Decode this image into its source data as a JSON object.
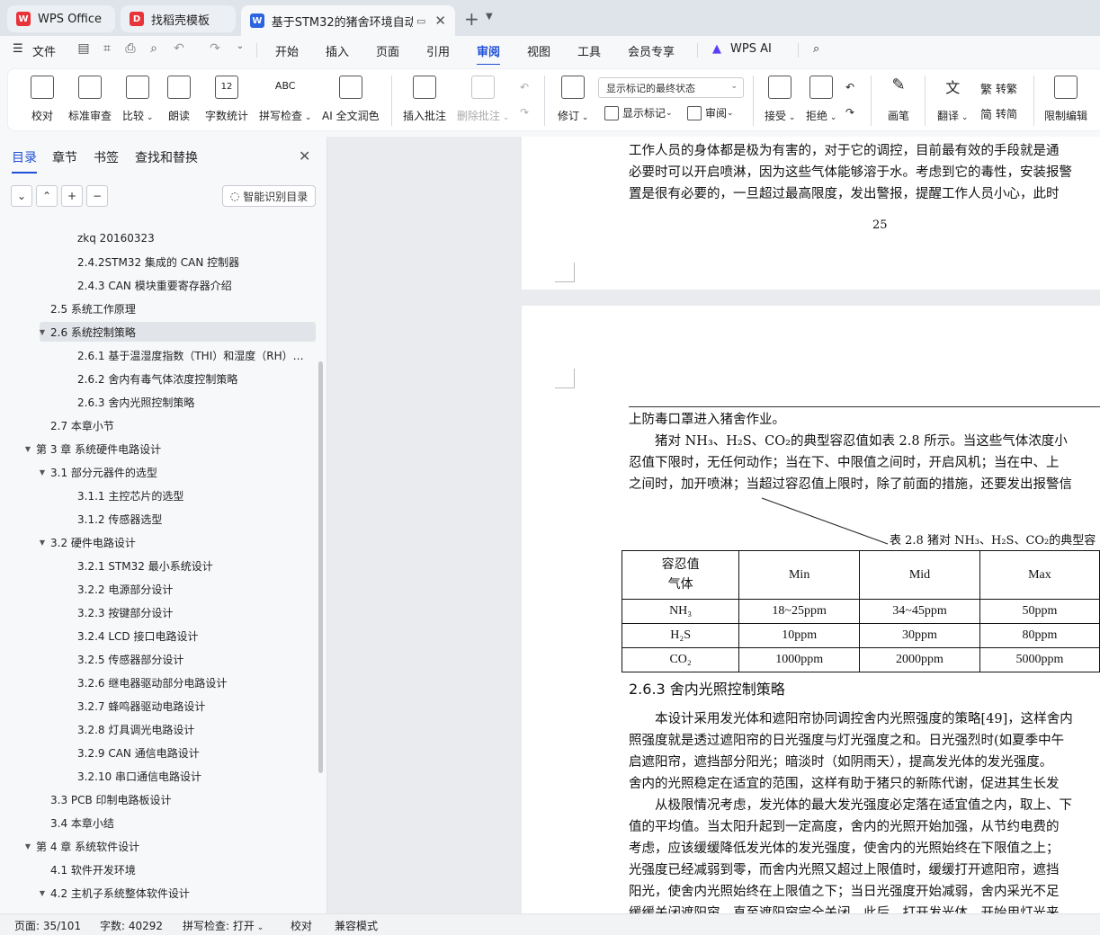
{
  "tabs": [
    {
      "label": "WPS Office"
    },
    {
      "label": "找稻壳模板"
    },
    {
      "label": "基于STM32的猪舍环境自动监"
    }
  ],
  "menu": {
    "file": "文件",
    "items": [
      "开始",
      "插入",
      "页面",
      "引用",
      "审阅",
      "视图",
      "工具",
      "会员专享",
      "WPS AI"
    ],
    "active": "审阅"
  },
  "ribbon": {
    "proofread": "校对",
    "standard_review": "标准审查",
    "compare": "比较",
    "read_aloud": "朗读",
    "word_count": "字数统计",
    "spell_check": "拼写检查",
    "ai_polish": "AI 全文润色",
    "insert_comment": "插入批注",
    "delete_comment": "删除批注",
    "track": "修订",
    "markup_select": "显示标记的最终状态",
    "show_markup": "显示标记",
    "review": "审阅",
    "accept": "接受",
    "reject": "拒绝",
    "pen": "画笔",
    "translate": "翻译",
    "to_traditional": "转繁",
    "to_simplified": "转简",
    "restrict_edit": "限制编辑",
    "abc": "ABC",
    "count_num": "12"
  },
  "nav": {
    "tabs": [
      "目录",
      "章节",
      "书签",
      "查找和替换"
    ],
    "smart_toc": "智能识别目录",
    "toc": [
      {
        "label": "zkq  20160323",
        "level": 3
      },
      {
        "label": "2.4.2STM32 集成的 CAN 控制器",
        "level": 3
      },
      {
        "label": "2.4.3 CAN 模块重要寄存器介绍",
        "level": 3
      },
      {
        "label": "2.5  系统工作原理",
        "level": 2
      },
      {
        "label": "2.6  系统控制策略",
        "level": 2,
        "expanded": true,
        "selected": true
      },
      {
        "label": "2.6.1 基于温湿度指数（THI）和湿度（RH）…",
        "level": 3
      },
      {
        "label": "2.6.2 舍内有毒气体浓度控制策略",
        "level": 3
      },
      {
        "label": "2.6.3 舍内光照控制策略",
        "level": 3
      },
      {
        "label": "2.7  本章小节",
        "level": 2
      },
      {
        "label": "第 3 章 系统硬件电路设计",
        "level": 1,
        "expanded": true
      },
      {
        "label": "3.1  部分元器件的选型",
        "level": 2,
        "expanded": true
      },
      {
        "label": "3.1.1 主控芯片的选型",
        "level": 3
      },
      {
        "label": "3.1.2 传感器选型",
        "level": 3
      },
      {
        "label": "3.2  硬件电路设计",
        "level": 2,
        "expanded": true
      },
      {
        "label": "3.2.1 STM32 最小系统设计",
        "level": 3
      },
      {
        "label": "3.2.2 电源部分设计",
        "level": 3
      },
      {
        "label": "3.2.3 按键部分设计",
        "level": 3
      },
      {
        "label": "3.2.4 LCD 接口电路设计",
        "level": 3
      },
      {
        "label": "3.2.5 传感器部分设计",
        "level": 3
      },
      {
        "label": "3.2.6 继电器驱动部分电路设计",
        "level": 3
      },
      {
        "label": "3.2.7 蜂鸣器驱动电路设计",
        "level": 3
      },
      {
        "label": "3.2.8 灯具调光电路设计",
        "level": 3
      },
      {
        "label": "3.2.9 CAN 通信电路设计",
        "level": 3
      },
      {
        "label": "3.2.10 串口通信电路设计",
        "level": 3
      },
      {
        "label": "3.3 PCB 印制电路板设计",
        "level": 2
      },
      {
        "label": "3.4  本章小结",
        "level": 2
      },
      {
        "label": "第 4 章 系统软件设计",
        "level": 1,
        "expanded": true
      },
      {
        "label": "4.1  软件开发环境",
        "level": 2
      },
      {
        "label": "4.2  主机子系统整体软件设计",
        "level": 2,
        "expanded": true
      }
    ]
  },
  "document": {
    "page1_lines": [
      "工作人员的身体都是极为有害的，对于它的调控，目前最有效的手段就是通",
      "必要时可以开启喷淋，因为这些气体能够溶于水。考虑到它的毒性，安装报警",
      "置是很有必要的，一旦超过最高限度，发出警报，提醒工作人员小心，此时"
    ],
    "page_number": "25",
    "page2_top_lines": [
      "上防毒口罩进入猪舍作业。",
      "　　猪对 NH₃、H₂S、CO₂的典型容忍值如表 2.8 所示。当这些气体浓度小",
      "忍值下限时，无任何动作；当在下、中限值之间时，开启风机；当在中、上",
      "之间时，加开喷淋；当超过容忍值上限时，除了前面的措施，还要发出报警信"
    ],
    "table_caption": "表 2.8  猪对 NH₃、H₂S、CO₂的典型容",
    "table": {
      "header_diag_top": "容忍值",
      "header_diag_bottom": "气体",
      "columns": [
        "Min",
        "Mid",
        "Max"
      ],
      "rows": [
        {
          "gas": "NH₃",
          "values": [
            "18~25ppm",
            "34~45ppm",
            "50ppm"
          ]
        },
        {
          "gas": "H₂S",
          "values": [
            "10ppm",
            "30ppm",
            "80ppm"
          ]
        },
        {
          "gas": "CO₂",
          "values": [
            "1000ppm",
            "2000ppm",
            "5000ppm"
          ]
        }
      ]
    },
    "heading": "2.6.3  舍内光照控制策略",
    "para_lines": [
      "　　本设计采用发光体和遮阳帘协同调控舍内光照强度的策略[49]，这样舍内",
      "照强度就是透过遮阳帘的日光强度与灯光强度之和。日光强烈时(如夏季中午",
      "启遮阳帘，遮挡部分阳光；暗淡时（如阴雨天），提高发光体的发光强度。",
      "舍内的光照稳定在适宜的范围，这样有助于猪只的新陈代谢，促进其生长发",
      "　　从极限情况考虑，发光体的最大发光强度必定落在适宜值之内，取上、下",
      "值的平均值。当太阳升起到一定高度，舍内的光照开始加强，从节约电费的",
      "考虑，应该缓缓降低发光体的发光强度，使舍内的光照始终在下限值之上；",
      "光强度已经减弱到零，而舍内光照又超过上限值时，缓缓打开遮阳帘，遮挡",
      "阳光，使舍内光照始终在上限值之下；当日光强度开始减弱，舍内采光不足",
      "缓缓关闭遮阳帘，直至遮阳帘完全关闭。此后，打开发光体，开始用灯光来"
    ]
  },
  "status": {
    "page": "页面: 35/101",
    "words": "字数: 40292",
    "spell": "拼写检查: 打开",
    "proof": "校对",
    "compat": "兼容模式"
  },
  "colors": {
    "accent": "#1f4fd6",
    "wps_red": "#e8333a"
  }
}
